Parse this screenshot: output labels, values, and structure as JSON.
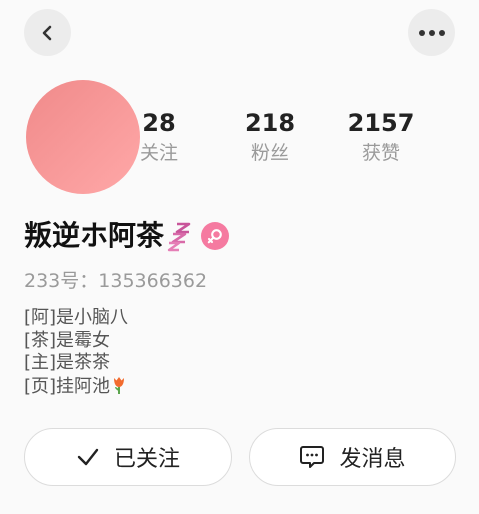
{
  "header": {
    "back_icon": "chevron-left-icon",
    "more_icon": "more-horizontal-icon"
  },
  "profile": {
    "name": "叛逆ホ阿茶",
    "gender": "female",
    "uid": "233号：135366362",
    "bio": [
      "[阿]是小脑八",
      "[茶]是霉女",
      "[主]是茶茶",
      "[页]挂阿池"
    ],
    "bio_emoji": "tulip-emoji",
    "accent_color": "#f57aa0"
  },
  "stats": [
    {
      "value": "28",
      "label": "关注"
    },
    {
      "value": "218",
      "label": "粉丝"
    },
    {
      "value": "2157",
      "label": "获赞"
    }
  ],
  "actions": {
    "follow_label": "已关注",
    "message_label": "发消息"
  }
}
